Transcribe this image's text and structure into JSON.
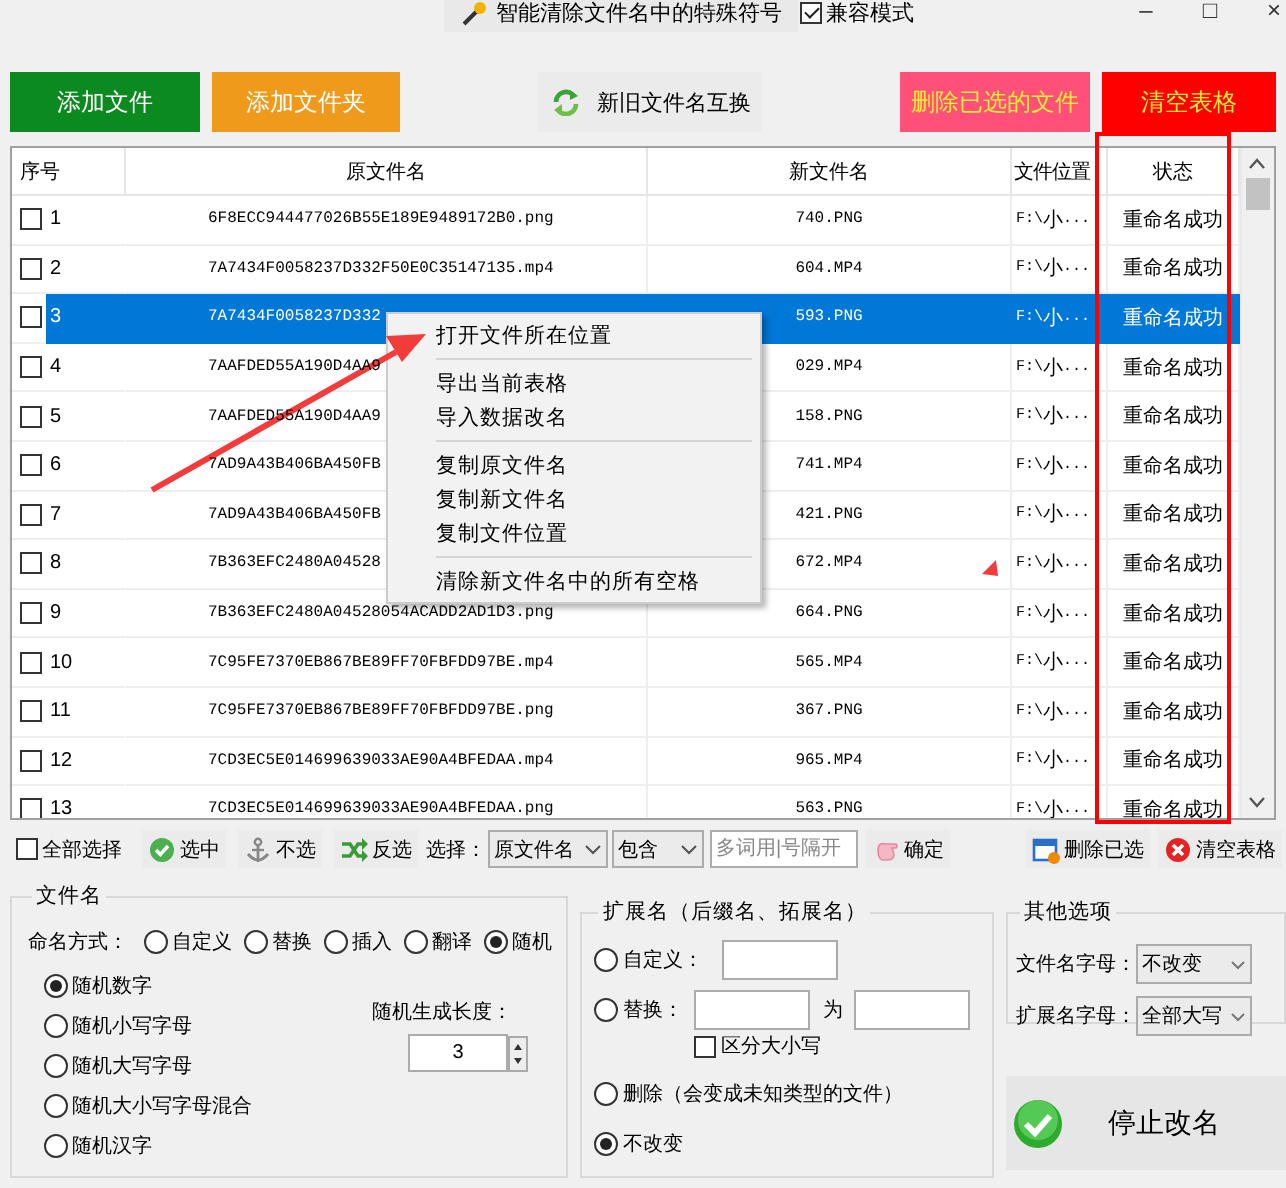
{
  "title_bar": {
    "clean_button": "智能清除文件名中的特殊符号",
    "compat": {
      "label": "兼容模式",
      "checked": true
    },
    "controls": [
      "–",
      "□",
      "×"
    ]
  },
  "top_buttons": [
    {
      "label": "添加文件",
      "kind": "green"
    },
    {
      "label": "添加文件夹",
      "kind": "orange"
    },
    {
      "label": "新旧文件名互换",
      "kind": "swap"
    },
    {
      "label": "删除已选的文件",
      "kind": "pink"
    },
    {
      "label": "清空表格",
      "kind": "red"
    }
  ],
  "table": {
    "columns": [
      "序号",
      "原文件名",
      "新文件名",
      "文件位置",
      "状态"
    ],
    "rows": [
      {
        "no": "1",
        "checked": false,
        "selected": false,
        "original": "6F8ECC944477026B55E189E9489172B0.png",
        "new": "740.PNG",
        "location": "F:\\小...",
        "status": "重命名成功"
      },
      {
        "no": "2",
        "checked": false,
        "selected": false,
        "original": "7A7434F0058237D332F50E0C35147135.mp4",
        "new": "604.MP4",
        "location": "F:\\小...",
        "status": "重命名成功"
      },
      {
        "no": "3",
        "checked": false,
        "selected": true,
        "original": "7A7434F0058237D332",
        "new": "593.PNG",
        "location": "F:\\小...",
        "status": "重命名成功"
      },
      {
        "no": "4",
        "checked": false,
        "selected": false,
        "original": "7AAFDED55A190D4AA9",
        "new": "029.MP4",
        "location": "F:\\小...",
        "status": "重命名成功"
      },
      {
        "no": "5",
        "checked": false,
        "selected": false,
        "original": "7AAFDED55A190D4AA9",
        "new": "158.PNG",
        "location": "F:\\小...",
        "status": "重命名成功"
      },
      {
        "no": "6",
        "checked": false,
        "selected": false,
        "original": "7AD9A43B406BA450FB",
        "new": "741.MP4",
        "location": "F:\\小...",
        "status": "重命名成功"
      },
      {
        "no": "7",
        "checked": false,
        "selected": false,
        "original": "7AD9A43B406BA450FB",
        "new": "421.PNG",
        "location": "F:\\小...",
        "status": "重命名成功"
      },
      {
        "no": "8",
        "checked": false,
        "selected": false,
        "original": "7B363EFC2480A04528",
        "new": "672.MP4",
        "location": "F:\\小...",
        "status": "重命名成功"
      },
      {
        "no": "9",
        "checked": false,
        "selected": false,
        "original": "7B363EFC2480A04528054ACADD2AD1D3.png",
        "new": "664.PNG",
        "location": "F:\\小...",
        "status": "重命名成功"
      },
      {
        "no": "10",
        "checked": false,
        "selected": false,
        "original": "7C95FE7370EB867BE89FF70FBFDD97BE.mp4",
        "new": "565.MP4",
        "location": "F:\\小...",
        "status": "重命名成功"
      },
      {
        "no": "11",
        "checked": false,
        "selected": false,
        "original": "7C95FE7370EB867BE89FF70FBFDD97BE.png",
        "new": "367.PNG",
        "location": "F:\\小...",
        "status": "重命名成功"
      },
      {
        "no": "12",
        "checked": false,
        "selected": false,
        "original": "7CD3EC5E014699639033AE90A4BFEDAA.mp4",
        "new": "965.MP4",
        "location": "F:\\小...",
        "status": "重命名成功"
      },
      {
        "no": "13",
        "checked": false,
        "selected": false,
        "original": "7CD3EC5E014699639033AE90A4BFEDAA.png",
        "new": "563.PNG",
        "location": "F:\\小...",
        "status": "重命名成功"
      }
    ]
  },
  "context_menu": [
    [
      "打开文件所在位置"
    ],
    [
      "导出当前表格",
      "导入数据改名"
    ],
    [
      "复制原文件名",
      "复制新文件名",
      "复制文件位置"
    ],
    [
      "清除新文件名中的所有空格"
    ]
  ],
  "toolbar": {
    "select_all": {
      "label": "全部选择",
      "checked": false
    },
    "actions": [
      {
        "label": "选中",
        "kind": "check"
      },
      {
        "label": "不选",
        "kind": "anchor"
      },
      {
        "label": "反选",
        "kind": "invert"
      }
    ],
    "filter_label": "选择：",
    "field_dropdown": "原文件名",
    "match_dropdown": "包含",
    "keywords": {
      "placeholder": "多词用|号隔开"
    },
    "confirm": "确定",
    "right_actions": [
      {
        "label": "删除已选",
        "kind": "delete"
      },
      {
        "label": "清空表格",
        "kind": "clear"
      }
    ]
  },
  "filename_group": {
    "title": "文件名",
    "mode_label": "命名方式：",
    "modes": [
      {
        "label": "自定义",
        "selected": false
      },
      {
        "label": "替换",
        "selected": false
      },
      {
        "label": "插入",
        "selected": false
      },
      {
        "label": "翻译",
        "selected": false
      },
      {
        "label": "随机",
        "selected": true
      }
    ],
    "random_types": [
      {
        "label": "随机数字",
        "selected": true
      },
      {
        "label": "随机小写字母",
        "selected": false
      },
      {
        "label": "随机大写字母",
        "selected": false
      },
      {
        "label": "随机大小写字母混合",
        "selected": false
      },
      {
        "label": "随机汉字",
        "selected": false
      }
    ],
    "length_label": "随机生成长度：",
    "length": "3"
  },
  "extension_group": {
    "title": "扩展名（后缀名、拓展名）",
    "options": [
      {
        "kind": "custom",
        "label": "自定义：",
        "selected": false
      },
      {
        "kind": "replace",
        "label": "替换：",
        "with": "为",
        "case": {
          "label": "区分大小写",
          "checked": false
        },
        "selected": false
      },
      {
        "kind": "plain",
        "label": "删除（会变成未知类型的文件）",
        "selected": false
      },
      {
        "kind": "plain",
        "label": "不改变",
        "selected": true
      }
    ]
  },
  "other_group": {
    "title": "其他选项",
    "rows": [
      {
        "label": "文件名字母：",
        "value": "不改变"
      },
      {
        "label": "扩展名字母：",
        "value": "全部大写"
      }
    ]
  },
  "stop_button": "停止改名"
}
